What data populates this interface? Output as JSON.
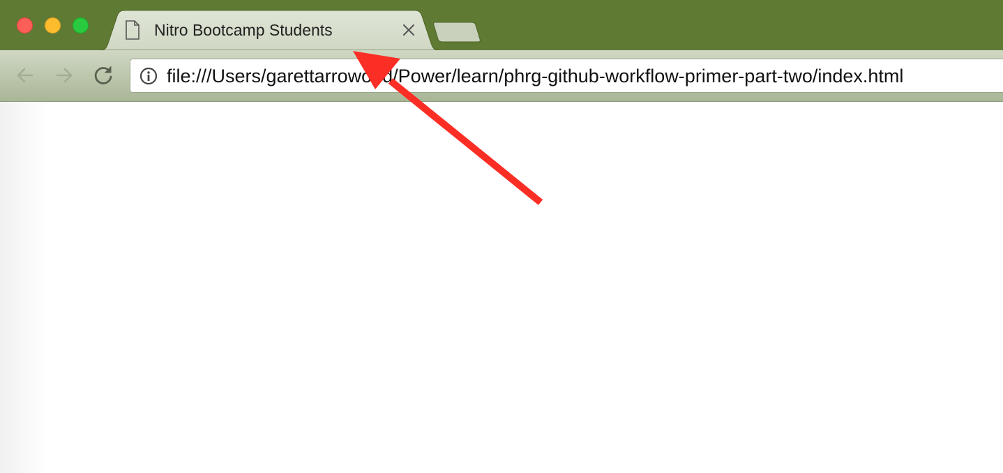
{
  "window": {
    "traffic_lights": {
      "close_color": "#fc5f57",
      "minimize_color": "#fdbc2e",
      "maximize_color": "#29c940"
    },
    "frame_color": "#5f7a33"
  },
  "tabs": [
    {
      "title": "Nitro Bootcamp Students",
      "icon": "document-icon",
      "active": true
    }
  ],
  "toolbar": {
    "back_icon": "arrow-left-icon",
    "forward_icon": "arrow-right-icon",
    "reload_icon": "reload-icon",
    "address": {
      "icon": "info-icon",
      "url": "file:///Users/garettarrowood/Power/learn/phrg-github-workflow-primer-part-two/index.html"
    }
  },
  "annotation": {
    "type": "arrow",
    "color": "#fb2e25",
    "points_to": "tab-title"
  }
}
